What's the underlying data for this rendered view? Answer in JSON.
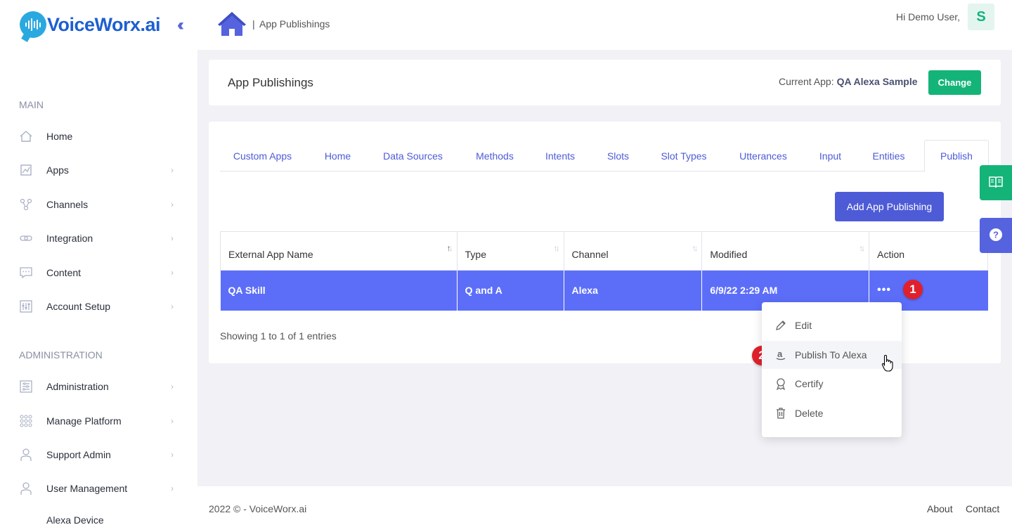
{
  "app": {
    "logo_text": "VoiceWorx.ai",
    "collapse_icon": "double-chevron-left-icon"
  },
  "sidebar": {
    "main_label": "MAIN",
    "admin_label": "ADMINISTRATION",
    "main_items": [
      {
        "label": "Home",
        "icon": "home-icon",
        "has_chevron": false
      },
      {
        "label": "Apps",
        "icon": "apps-icon",
        "has_chevron": true
      },
      {
        "label": "Channels",
        "icon": "channels-icon",
        "has_chevron": true
      },
      {
        "label": "Integration",
        "icon": "integration-icon",
        "has_chevron": true
      },
      {
        "label": "Content",
        "icon": "content-icon",
        "has_chevron": true
      },
      {
        "label": "Account Setup",
        "icon": "account-setup-icon",
        "has_chevron": true
      }
    ],
    "admin_items": [
      {
        "label": "Administration",
        "icon": "administration-icon",
        "has_chevron": true
      },
      {
        "label": "Manage Platform",
        "icon": "manage-platform-icon",
        "has_chevron": true
      },
      {
        "label": "Support Admin",
        "icon": "user-icon",
        "has_chevron": true
      },
      {
        "label": "User Management",
        "icon": "user-icon",
        "has_chevron": true
      },
      {
        "label": "Alexa Device",
        "icon": "",
        "has_chevron": false
      }
    ]
  },
  "topbar": {
    "breadcrumb_sep": "|",
    "breadcrumb": "App Publishings",
    "greeting": "Hi Demo User,",
    "avatar_letter": "S"
  },
  "header": {
    "title": "App Publishings",
    "current_app_label": "Current App:",
    "current_app_name": "QA Alexa Sample",
    "change_label": "Change"
  },
  "tabs": [
    {
      "label": "Custom Apps",
      "active": false
    },
    {
      "label": "Home",
      "active": false
    },
    {
      "label": "Data Sources",
      "active": false
    },
    {
      "label": "Methods",
      "active": false
    },
    {
      "label": "Intents",
      "active": false
    },
    {
      "label": "Slots",
      "active": false
    },
    {
      "label": "Slot Types",
      "active": false
    },
    {
      "label": "Utterances",
      "active": false
    },
    {
      "label": "Input",
      "active": false
    },
    {
      "label": "Entities",
      "active": false
    },
    {
      "label": "Publish",
      "active": true
    }
  ],
  "add_button_label": "Add App Publishing",
  "table": {
    "columns": [
      "External App Name",
      "Type",
      "Channel",
      "Modified",
      "Action"
    ],
    "rows": [
      {
        "name": "QA Skill",
        "type": "Q and A",
        "channel": "Alexa",
        "modified": "6/9/22 2:29 AM",
        "action": "•••"
      }
    ],
    "entries_text": "Showing 1 to 1 of 1 entries"
  },
  "action_menu": {
    "items": [
      {
        "label": "Edit",
        "icon": "pencil-icon"
      },
      {
        "label": "Publish To Alexa",
        "icon": "amazon-icon"
      },
      {
        "label": "Certify",
        "icon": "award-icon"
      },
      {
        "label": "Delete",
        "icon": "trash-icon"
      }
    ]
  },
  "badges": {
    "one": "1",
    "two": "2"
  },
  "floating": {
    "docs_icon": "book-icon",
    "help_icon": "question-icon",
    "docs_color": "#14b479",
    "help_color": "#5563de"
  },
  "footer": {
    "copyright": "2022 ©  -  VoiceWorx.ai",
    "about": "About",
    "contact": "Contact"
  },
  "colors": {
    "accent": "#4e5bd6",
    "row_highlight": "#5c6ef8",
    "success": "#14b479",
    "badge": "#e0202b"
  }
}
